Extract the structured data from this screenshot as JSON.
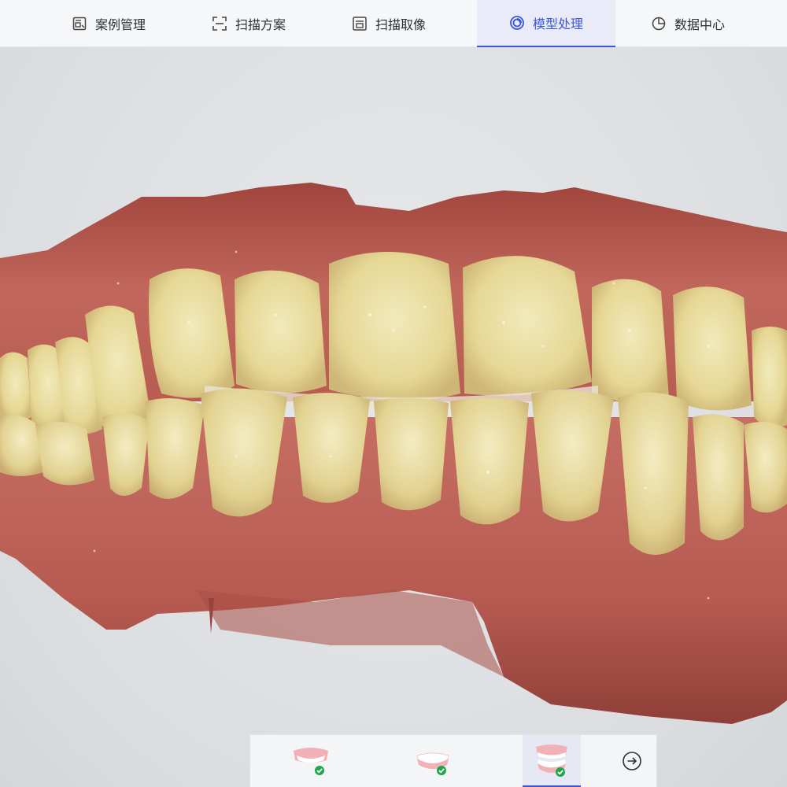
{
  "nav": {
    "tabs": [
      {
        "label": "案例管理",
        "icon": "case-management-icon"
      },
      {
        "label": "扫描方案",
        "icon": "scan-plan-icon"
      },
      {
        "label": "扫描取像",
        "icon": "scan-capture-icon"
      },
      {
        "label": "模型处理",
        "icon": "model-processing-icon"
      },
      {
        "label": "数据中心",
        "icon": "data-center-icon"
      }
    ],
    "active_index": 3
  },
  "jaw_selector": {
    "items": [
      {
        "icon": "upper-jaw-icon",
        "status": "done"
      },
      {
        "icon": "lower-jaw-icon",
        "status": "done"
      },
      {
        "icon": "bite-icon",
        "status": "done"
      }
    ],
    "active_index": 2,
    "next_icon": "arrow-right-circle-icon"
  },
  "colors": {
    "accent": "#3d56d9",
    "check": "#1ea64a",
    "gum": "#b4584f",
    "tooth": "#ece0a3"
  }
}
